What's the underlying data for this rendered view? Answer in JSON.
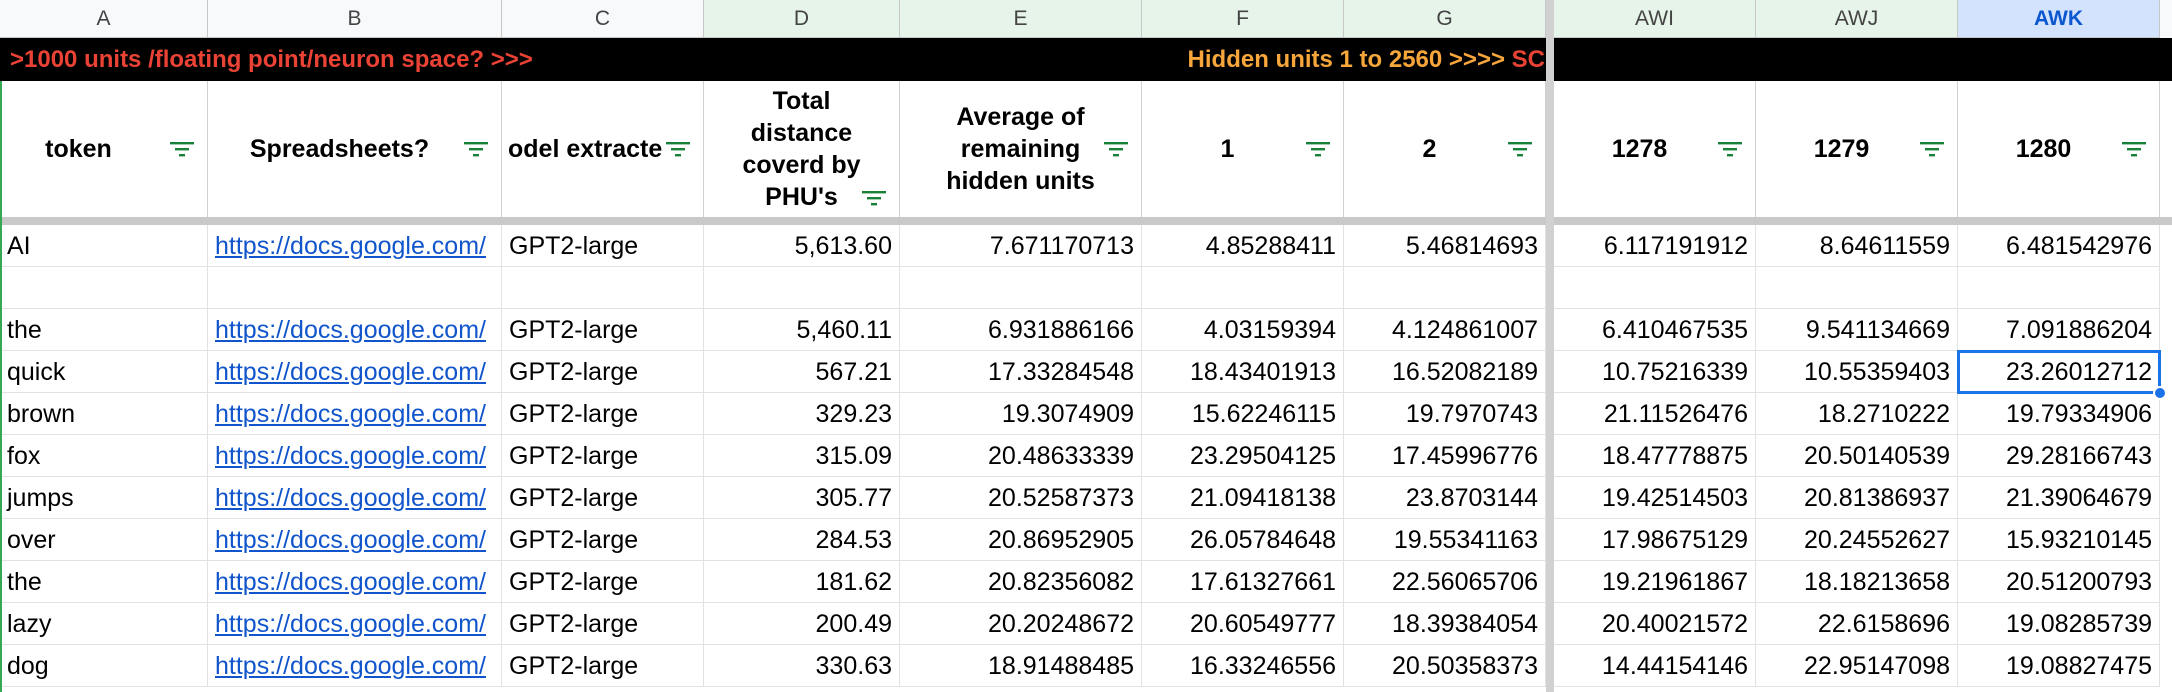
{
  "columns": [
    "A",
    "B",
    "C",
    "D",
    "E",
    "F",
    "G",
    "AWI",
    "AWJ",
    "AWK"
  ],
  "active_column": "AWK",
  "banner": {
    "left_text": ">1000 units /floating point/neuron space? >>>",
    "right_text_orange": "Hidden units 1 to 2560 >>>> ",
    "right_text_red": "SC"
  },
  "headers": [
    "token",
    "Spreadsheets?",
    "odel extracte",
    "Total distance coverd by PHU's",
    "Average of remaining hidden units",
    "1",
    "2",
    "1278",
    "1279",
    "1280"
  ],
  "rows": [
    [
      "AI",
      "https://docs.google.com/",
      "GPT2-large",
      "5,613.60",
      "7.671170713",
      "4.85288411",
      "5.46814693",
      "6.117191912",
      "8.64611559",
      "6.481542976"
    ],
    [
      "",
      "",
      "",
      "",
      "",
      "",
      "",
      "",
      "",
      ""
    ],
    [
      "the",
      "https://docs.google.com/",
      "GPT2-large",
      "5,460.11",
      "6.931886166",
      "4.03159394",
      "4.124861007",
      "6.410467535",
      "9.541134669",
      "7.091886204"
    ],
    [
      "quick",
      "https://docs.google.com/",
      "GPT2-large",
      "567.21",
      "17.33284548",
      "18.43401913",
      "16.52082189",
      "10.75216339",
      "10.55359403",
      "23.26012712"
    ],
    [
      "brown",
      "https://docs.google.com/",
      "GPT2-large",
      "329.23",
      "19.3074909",
      "15.62246115",
      "19.7970743",
      "21.11526476",
      "18.2710222",
      "19.79334906"
    ],
    [
      "fox",
      "https://docs.google.com/",
      "GPT2-large",
      "315.09",
      "20.48633339",
      "23.29504125",
      "17.45996776",
      "18.47778875",
      "20.50140539",
      "29.28166743"
    ],
    [
      "jumps",
      "https://docs.google.com/",
      "GPT2-large",
      "305.77",
      "20.52587373",
      "21.09418138",
      "23.8703144",
      "19.42514503",
      "20.81386937",
      "21.39064679"
    ],
    [
      "over",
      "https://docs.google.com/",
      "GPT2-large",
      "284.53",
      "20.86952905",
      "26.05784648",
      "19.55341163",
      "17.98675129",
      "20.24552627",
      "15.93210145"
    ],
    [
      "the",
      "https://docs.google.com/",
      "GPT2-large",
      "181.62",
      "20.82356082",
      "17.61327661",
      "22.56065706",
      "19.21961867",
      "18.18213658",
      "20.51200793"
    ],
    [
      "lazy",
      "https://docs.google.com/",
      "GPT2-large",
      "200.49",
      "20.20248672",
      "20.60549777",
      "18.39384054",
      "20.40021572",
      "22.6158696",
      "19.08285739"
    ],
    [
      "dog",
      "https://docs.google.com/",
      "GPT2-large",
      "330.63",
      "18.91488485",
      "16.33246556",
      "20.50358373",
      "14.44154146",
      "22.95147098",
      "19.08827475"
    ]
  ],
  "selected_cell": "AWK row quick",
  "colors": {
    "link": "#1155cc",
    "selection": "#1a73e8",
    "banner_red": "#ea4335",
    "banner_orange": "#f6a63a",
    "filter_green": "#188038"
  },
  "icons": {
    "filter": "filter-icon"
  }
}
